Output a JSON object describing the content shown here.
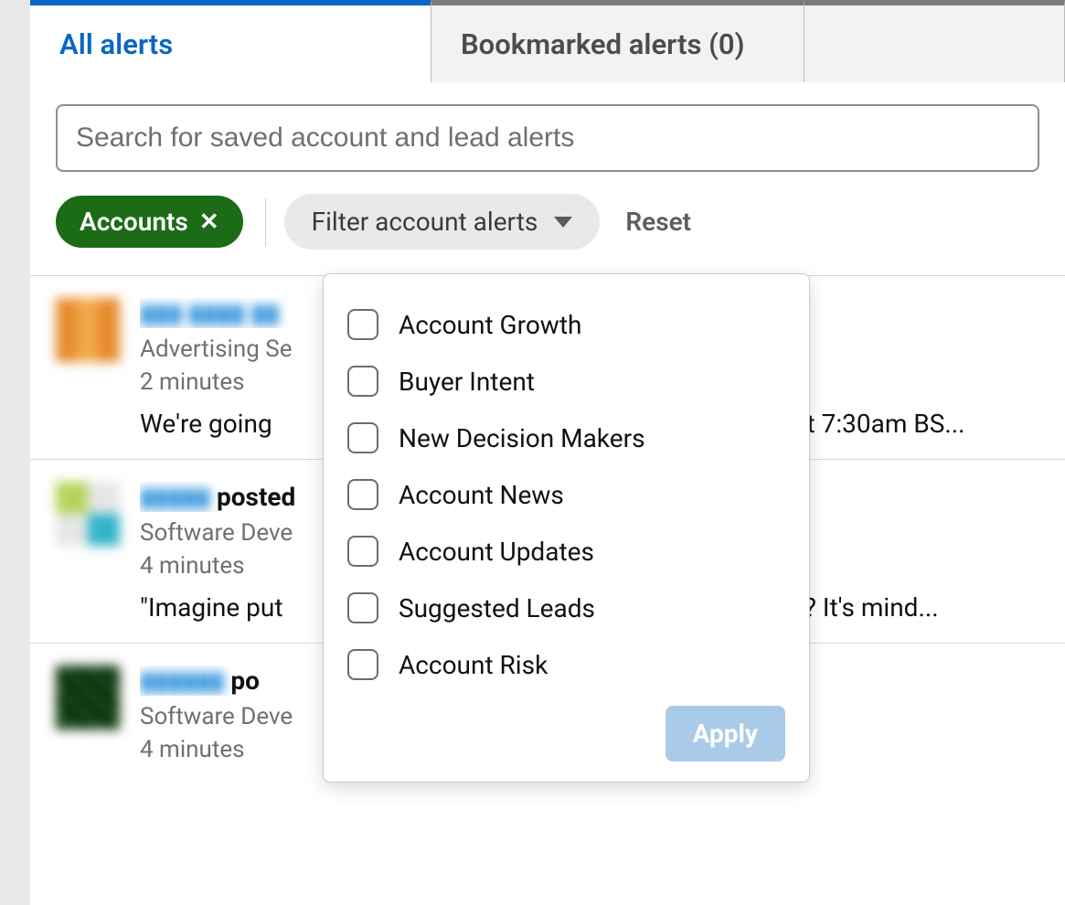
{
  "tabs": {
    "all": "All alerts",
    "bookmarked": "Bookmarked alerts (0)"
  },
  "search": {
    "placeholder": "Search for saved account and lead alerts"
  },
  "filters": {
    "accounts_label": "Accounts",
    "dropdown_label": "Filter account alerts",
    "reset": "Reset"
  },
  "dropdown": {
    "options": [
      "Account Growth",
      "Buyer Intent",
      "New Decision Makers",
      "Account News",
      "Account Updates",
      "Suggested Leads",
      "Account Risk"
    ],
    "apply": "Apply"
  },
  "alerts": [
    {
      "title_link": "▮▮▮ ▮▮▮▮ ▮▮",
      "title_rest": "",
      "sub": "Advertising Se",
      "time": "2 minutes",
      "snippet_left": "We're going ",
      "snippet_right": "ez at 7:30am BS..."
    },
    {
      "title_link": "▮▮▮▮▮",
      "title_rest": " posted",
      "sub": "Software Deve",
      "time": "4 minutes",
      "snippet_left": "\"Imagine put",
      "snippet_right": "cel? It's mind..."
    },
    {
      "title_link": "▮▮▮▮▮▮",
      "title_rest": " po",
      "sub": "Software Deve",
      "time": "4 minutes",
      "snippet_left": "",
      "snippet_right": ""
    }
  ]
}
